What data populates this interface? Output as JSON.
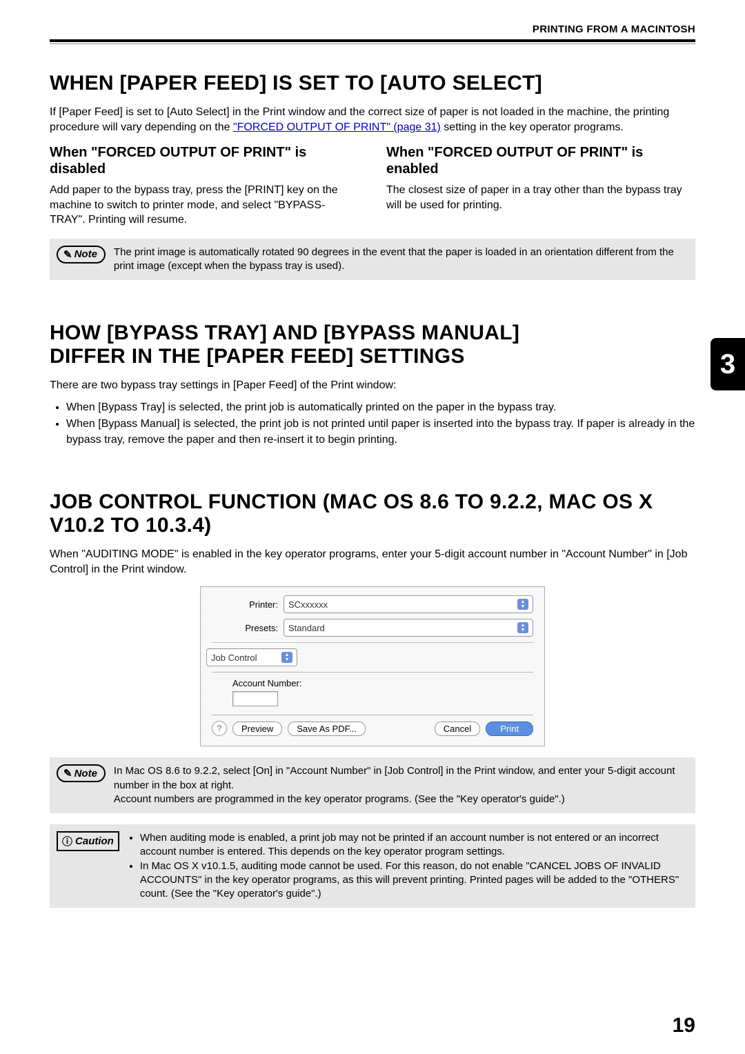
{
  "header": "PRINTING FROM A MACINTOSH",
  "chapter_number": "3",
  "page_number": "19",
  "sec1": {
    "title": "WHEN [PAPER FEED] IS SET TO [AUTO SELECT]",
    "intro_pre": "If [Paper Feed] is set to [Auto Select] in the Print window and the correct size of paper is not loaded in the machine, the printing procedure will vary depending on the ",
    "link": "\"FORCED OUTPUT OF PRINT\" (page 31)",
    "intro_post": " setting in the key operator programs.",
    "left_h": "When \"FORCED OUTPUT OF PRINT\" is disabled",
    "left_p": "Add paper to the bypass tray, press the [PRINT] key on the machine to switch to printer mode, and select \"BYPASS-TRAY\". Printing will resume.",
    "right_h": "When \"FORCED OUTPUT OF PRINT\" is enabled",
    "right_p": "The closest size of paper in a tray other than the bypass tray will be used for printing.",
    "note": "The print image is automatically rotated 90 degrees in the event that the paper is loaded in an orientation different from the print image (except when the bypass tray is used)."
  },
  "sec2": {
    "title": "HOW [BYPASS TRAY] AND [BYPASS MANUAL] DIFFER IN THE [PAPER FEED] SETTINGS",
    "intro": "There are two bypass tray settings in [Paper Feed] of the Print window:",
    "b1": "When [Bypass Tray] is selected, the print job is automatically printed on the paper in the bypass tray.",
    "b2": "When [Bypass Manual] is selected, the print job is not printed until paper is inserted into the bypass tray. If paper is already in the bypass tray, remove the paper and then re-insert it to begin printing."
  },
  "sec3": {
    "title": "JOB CONTROL FUNCTION (MAC OS 8.6 TO 9.2.2, MAC OS X V10.2 TO 10.3.4)",
    "intro": "When \"AUDITING MODE\" is enabled in the key operator programs, enter your 5-digit account number in \"Account Number\" in [Job Control] in the Print window.",
    "dialog": {
      "printer_label": "Printer:",
      "printer_value": "SCxxxxxx",
      "presets_label": "Presets:",
      "presets_value": "Standard",
      "panel": "Job Control",
      "acct_label": "Account Number:",
      "help": "?",
      "preview": "Preview",
      "save": "Save As PDF...",
      "cancel": "Cancel",
      "print": "Print"
    },
    "note": "In Mac OS 8.6 to 9.2.2, select [On] in \"Account Number\" in [Job Control] in the Print window, and enter your 5-digit account number in the box at right.\nAccount numbers are programmed in the key operator programs. (See the \"Key operator's guide\".)",
    "caution_b1": "When auditing mode is enabled, a print job may not be printed if an account number is not entered or an incorrect account number is entered. This depends on the key operator program settings.",
    "caution_b2": "In Mac OS X v10.1.5, auditing mode cannot be used. For this reason, do not enable \"CANCEL JOBS OF INVALID ACCOUNTS\" in the key operator programs, as this will prevent printing. Printed pages will be added to the \"OTHERS\" count. (See the \"Key operator's guide\".)"
  },
  "labels": {
    "note": "Note",
    "caution": "Caution"
  }
}
